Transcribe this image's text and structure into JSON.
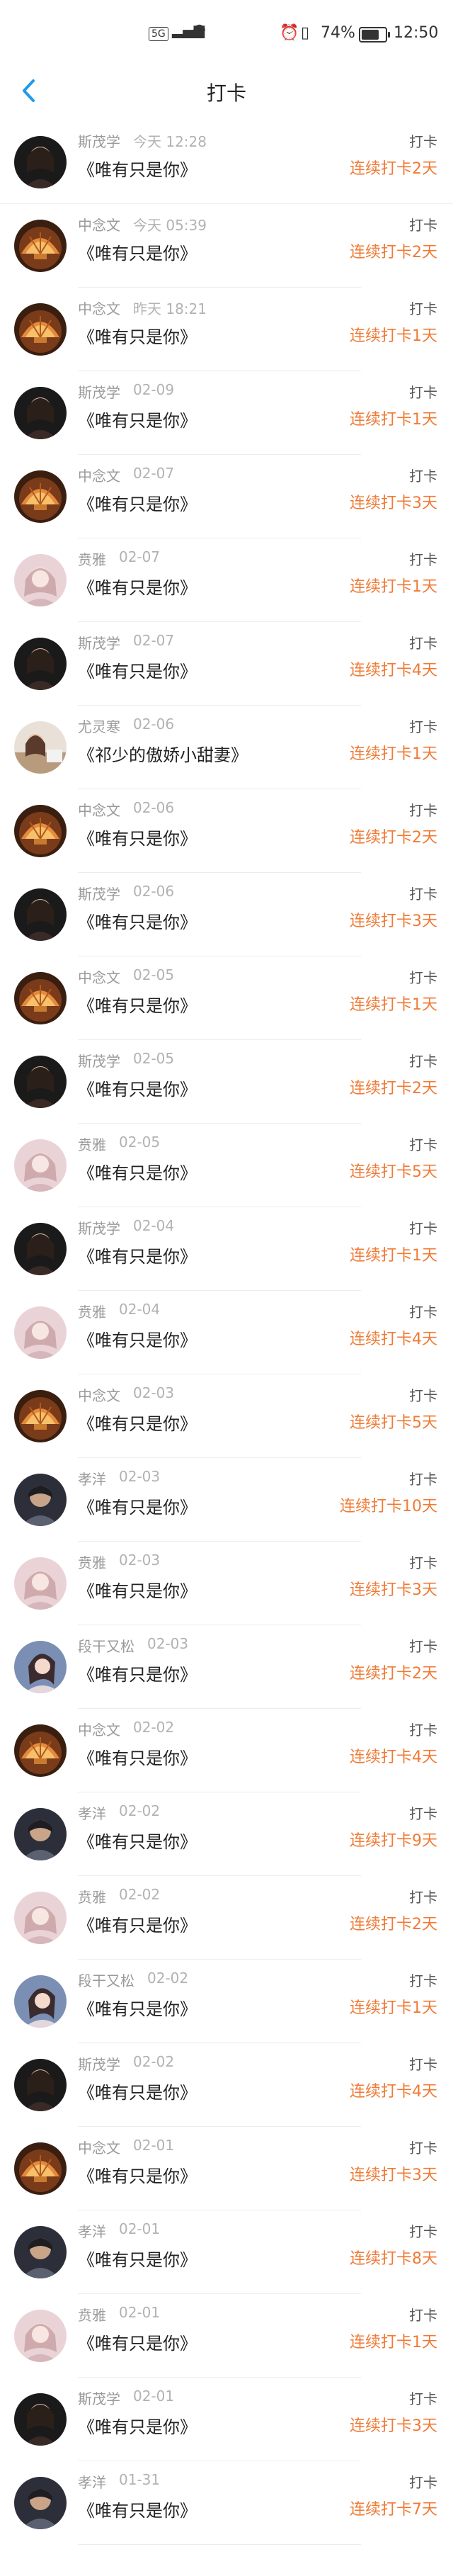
{
  "status_bar": {
    "network": "5G",
    "battery_percent": "74%",
    "battery_level": 0.74,
    "time": "12:50",
    "signal_icon": "signal-icon",
    "wifi_icon": "wifi-icon",
    "alarm_icon": "alarm-icon",
    "vibrate_icon": "vibrate-icon"
  },
  "nav": {
    "title": "打卡",
    "back_icon": "chevron-left-icon"
  },
  "colors": {
    "accent": "#1e9be9",
    "streak": "#f07a35"
  },
  "records": [
    {
      "user": "斯茂学",
      "time": "今天 12:28",
      "book": "《唯有只是你》",
      "tag": "打卡",
      "streak": "连续打卡2天",
      "avatar": "dark"
    },
    {
      "user": "中念文",
      "time": "今天 05:39",
      "book": "《唯有只是你》",
      "tag": "打卡",
      "streak": "连续打卡2天",
      "avatar": "shell"
    },
    {
      "user": "中念文",
      "time": "昨天 18:21",
      "book": "《唯有只是你》",
      "tag": "打卡",
      "streak": "连续打卡1天",
      "avatar": "shell"
    },
    {
      "user": "斯茂学",
      "time": "02-09",
      "book": "《唯有只是你》",
      "tag": "打卡",
      "streak": "连续打卡1天",
      "avatar": "dark"
    },
    {
      "user": "中念文",
      "time": "02-07",
      "book": "《唯有只是你》",
      "tag": "打卡",
      "streak": "连续打卡3天",
      "avatar": "shell"
    },
    {
      "user": "贲雅",
      "time": "02-07",
      "book": "《唯有只是你》",
      "tag": "打卡",
      "streak": "连续打卡1天",
      "avatar": "pink"
    },
    {
      "user": "斯茂学",
      "time": "02-07",
      "book": "《唯有只是你》",
      "tag": "打卡",
      "streak": "连续打卡4天",
      "avatar": "dark"
    },
    {
      "user": "尤灵寒",
      "time": "02-06",
      "book": "《祁少的傲娇小甜妻》",
      "tag": "打卡",
      "streak": "连续打卡1天",
      "avatar": "square"
    },
    {
      "user": "中念文",
      "time": "02-06",
      "book": "《唯有只是你》",
      "tag": "打卡",
      "streak": "连续打卡2天",
      "avatar": "shell"
    },
    {
      "user": "斯茂学",
      "time": "02-06",
      "book": "《唯有只是你》",
      "tag": "打卡",
      "streak": "连续打卡3天",
      "avatar": "dark"
    },
    {
      "user": "中念文",
      "time": "02-05",
      "book": "《唯有只是你》",
      "tag": "打卡",
      "streak": "连续打卡1天",
      "avatar": "shell"
    },
    {
      "user": "斯茂学",
      "time": "02-05",
      "book": "《唯有只是你》",
      "tag": "打卡",
      "streak": "连续打卡2天",
      "avatar": "dark"
    },
    {
      "user": "贲雅",
      "time": "02-05",
      "book": "《唯有只是你》",
      "tag": "打卡",
      "streak": "连续打卡5天",
      "avatar": "pink"
    },
    {
      "user": "斯茂学",
      "time": "02-04",
      "book": "《唯有只是你》",
      "tag": "打卡",
      "streak": "连续打卡1天",
      "avatar": "dark"
    },
    {
      "user": "贲雅",
      "time": "02-04",
      "book": "《唯有只是你》",
      "tag": "打卡",
      "streak": "连续打卡4天",
      "avatar": "pink"
    },
    {
      "user": "中念文",
      "time": "02-03",
      "book": "《唯有只是你》",
      "tag": "打卡",
      "streak": "连续打卡5天",
      "avatar": "shell"
    },
    {
      "user": "孝洋",
      "time": "02-03",
      "book": "《唯有只是你》",
      "tag": "打卡",
      "streak": "连续打卡10天",
      "avatar": "man"
    },
    {
      "user": "贲雅",
      "time": "02-03",
      "book": "《唯有只是你》",
      "tag": "打卡",
      "streak": "连续打卡3天",
      "avatar": "pink"
    },
    {
      "user": "段干又松",
      "time": "02-03",
      "book": "《唯有只是你》",
      "tag": "打卡",
      "streak": "连续打卡2天",
      "avatar": "girl"
    },
    {
      "user": "中念文",
      "time": "02-02",
      "book": "《唯有只是你》",
      "tag": "打卡",
      "streak": "连续打卡4天",
      "avatar": "shell"
    },
    {
      "user": "孝洋",
      "time": "02-02",
      "book": "《唯有只是你》",
      "tag": "打卡",
      "streak": "连续打卡9天",
      "avatar": "man"
    },
    {
      "user": "贲雅",
      "time": "02-02",
      "book": "《唯有只是你》",
      "tag": "打卡",
      "streak": "连续打卡2天",
      "avatar": "pink"
    },
    {
      "user": "段干又松",
      "time": "02-02",
      "book": "《唯有只是你》",
      "tag": "打卡",
      "streak": "连续打卡1天",
      "avatar": "girl"
    },
    {
      "user": "斯茂学",
      "time": "02-02",
      "book": "《唯有只是你》",
      "tag": "打卡",
      "streak": "连续打卡4天",
      "avatar": "dark"
    },
    {
      "user": "中念文",
      "time": "02-01",
      "book": "《唯有只是你》",
      "tag": "打卡",
      "streak": "连续打卡3天",
      "avatar": "shell"
    },
    {
      "user": "孝洋",
      "time": "02-01",
      "book": "《唯有只是你》",
      "tag": "打卡",
      "streak": "连续打卡8天",
      "avatar": "man"
    },
    {
      "user": "贲雅",
      "time": "02-01",
      "book": "《唯有只是你》",
      "tag": "打卡",
      "streak": "连续打卡1天",
      "avatar": "pink"
    },
    {
      "user": "斯茂学",
      "time": "02-01",
      "book": "《唯有只是你》",
      "tag": "打卡",
      "streak": "连续打卡3天",
      "avatar": "dark"
    },
    {
      "user": "孝洋",
      "time": "01-31",
      "book": "《唯有只是你》",
      "tag": "打卡",
      "streak": "连续打卡7天",
      "avatar": "man"
    }
  ]
}
